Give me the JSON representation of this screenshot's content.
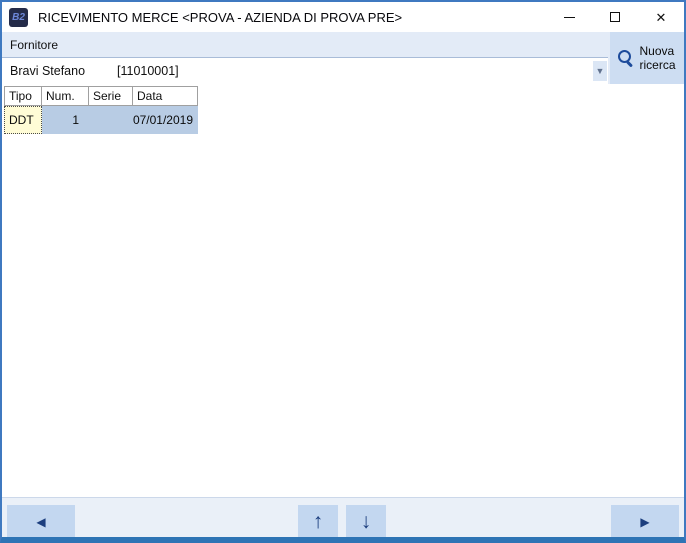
{
  "window": {
    "title": "RICEVIMENTO MERCE <PROVA - AZIENDA DI PROVA PRE>",
    "app_icon_text": "B2",
    "close_glyph": "✕"
  },
  "supplier": {
    "label": "Fornitore",
    "name": "Bravi Stefano",
    "code": "[11010001]",
    "dropdown_glyph": "▼"
  },
  "search_button": {
    "line1": "Nuova",
    "line2": "ricerca"
  },
  "table": {
    "headers": [
      "Tipo",
      "Num.",
      "Serie",
      "Data"
    ],
    "rows": [
      {
        "tipo": "DDT",
        "num": "1",
        "serie": "",
        "data": "07/01/2019"
      }
    ]
  },
  "nav": {
    "prev": "◀",
    "up": "↑",
    "down": "↓",
    "next": "▶"
  },
  "colors": {
    "window_border": "#3f79c0",
    "window_bottom_strip": "#2e74b5",
    "panel_bg": "#e3ebf7",
    "search_button_bg": "#cdddf2",
    "nav_button_bg": "#c3d7f0",
    "selected_row_bg": "#b8cce4",
    "focused_cell_bg": "#fffcd6",
    "icon_navy": "#1d4b9b"
  }
}
